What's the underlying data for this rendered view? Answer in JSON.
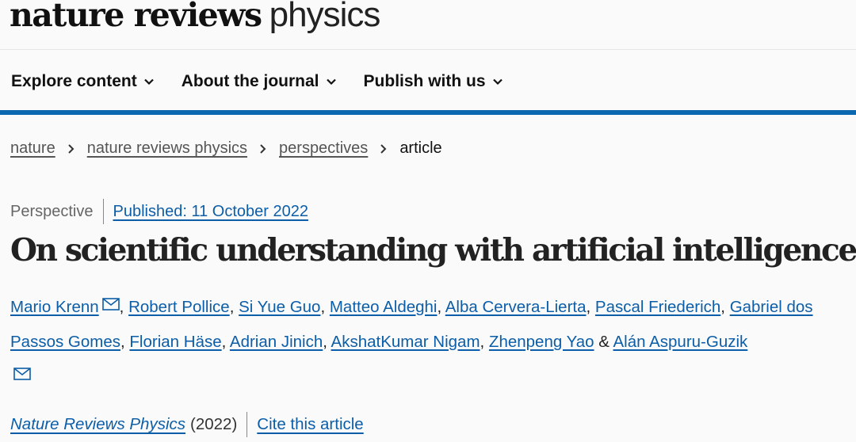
{
  "header": {
    "logo_bold": "nature reviews",
    "logo_light": "physics"
  },
  "nav": {
    "items": [
      {
        "label": "Explore content"
      },
      {
        "label": "About the journal"
      },
      {
        "label": "Publish with us"
      }
    ],
    "accent_color": "#0c67b1"
  },
  "breadcrumb": {
    "items": [
      "nature",
      "nature reviews physics",
      "perspectives"
    ],
    "current": "article"
  },
  "article": {
    "type": "Perspective",
    "published": "Published: 11 October 2022",
    "title": "On scientific understanding with artificial intelligence",
    "authors": [
      "Mario Krenn",
      "Robert Pollice",
      "Si Yue Guo",
      "Matteo Aldeghi",
      "Alba Cervera-Lierta",
      "Pascal Friederich",
      "Gabriel dos Passos Gomes",
      "Florian Häse",
      "Adrian Jinich",
      "AkshatKumar Nigam",
      "Zhenpeng Yao",
      "Alán Aspuru-Guzik"
    ],
    "authors_and": "&",
    "journal": "Nature Reviews Physics",
    "year": "(2022)",
    "cite_label": "Cite this article",
    "link_color": "#0c5ea8"
  }
}
